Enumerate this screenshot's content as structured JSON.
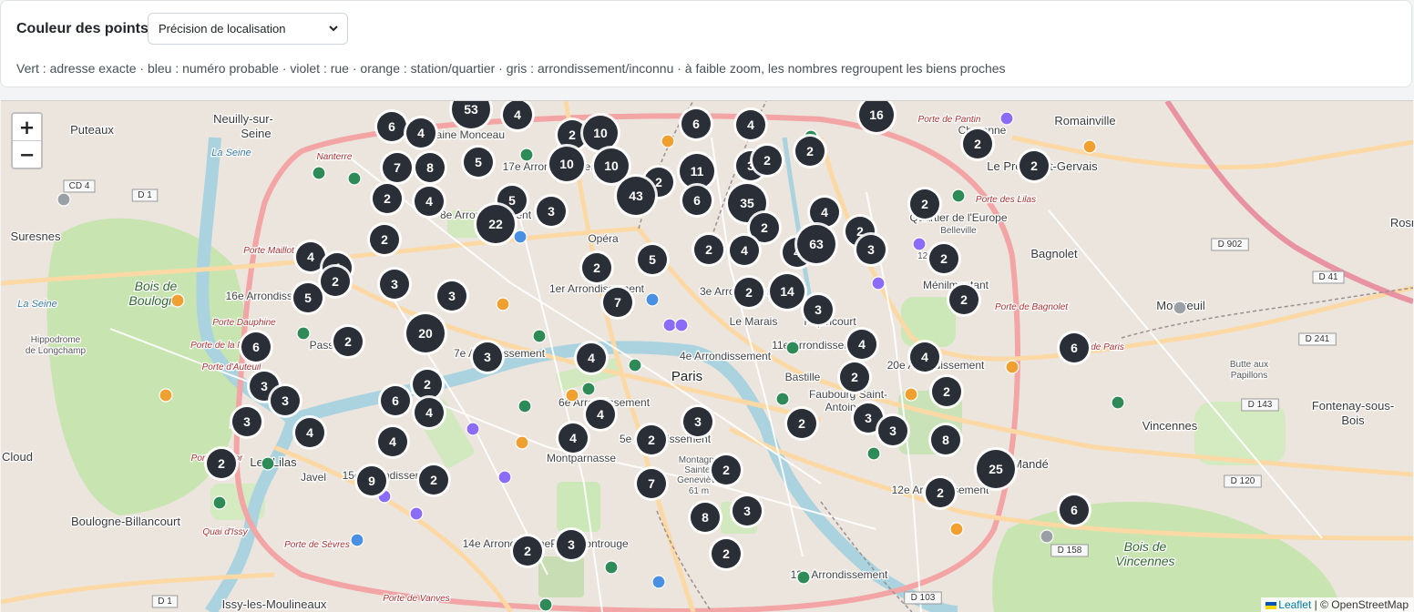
{
  "controls": {
    "color_label": "Couleur des points",
    "color_select_value": "Précision de localisation",
    "legend_text": "Vert : adresse exacte · bleu : numéro probable · violet : rue · orange : station/quartier · gris : arrondissement/inconnu · à faible zoom, les nombres regroupent les biens proches"
  },
  "map": {
    "zoom_in": "+",
    "zoom_out": "−",
    "attribution": {
      "leaflet": "Leaflet",
      "separator": " | © ",
      "osm": "OpenStreetMap"
    },
    "colors": {
      "exact": "#2e8b57",
      "probable": "#4a90e2",
      "street": "#8b6cf6",
      "station": "#f0a030",
      "unknown": "#9aa0a6",
      "cluster": "#2a2e37"
    },
    "place_labels": [
      {
        "text": "Puteaux",
        "cls": "town"
      },
      {
        "text": "Neuilly-sur-",
        "cls": "town"
      },
      {
        "text": "Seine",
        "cls": "town"
      },
      {
        "text": "Suresnes",
        "cls": "town"
      },
      {
        "text": "Bois de",
        "cls": "park"
      },
      {
        "text": "Boulogne",
        "cls": "park"
      },
      {
        "text": "Hippodrome",
        "cls": "small"
      },
      {
        "text": "de Longchamp",
        "cls": "small"
      },
      {
        "text": "Boulogne-Billancourt",
        "cls": "town"
      },
      {
        "text": "Cloud",
        "cls": "town"
      },
      {
        "text": "Issy-les-Moulineaux",
        "cls": "town"
      },
      {
        "text": "Romainville",
        "cls": "town"
      },
      {
        "text": "Bagnolet",
        "cls": "town"
      },
      {
        "text": "Montreuil",
        "cls": "town"
      },
      {
        "text": "Vincennes",
        "cls": "town"
      },
      {
        "text": "Saint-Mandé",
        "cls": "town"
      },
      {
        "text": "Fontenay-sous-",
        "cls": "town"
      },
      {
        "text": "Bois",
        "cls": "town"
      },
      {
        "text": "Bois de",
        "cls": "park"
      },
      {
        "text": "Vincennes",
        "cls": "park"
      },
      {
        "text": "Butte aux",
        "cls": "small"
      },
      {
        "text": "Papillons",
        "cls": "small"
      },
      {
        "text": "Rosn",
        "cls": "town"
      },
      {
        "text": "Paris",
        "cls": "city"
      },
      {
        "text": "Opéra",
        "cls": "district"
      },
      {
        "text": "1er Arrondissement",
        "cls": "district"
      },
      {
        "text": "3e Arrondissement",
        "cls": "district"
      },
      {
        "text": "Le Marais",
        "cls": "district"
      },
      {
        "text": "4e Arrondissement",
        "cls": "district"
      },
      {
        "text": "Bastille",
        "cls": "district"
      },
      {
        "text": "11e Arrondissement",
        "cls": "district"
      },
      {
        "text": "Popincourt",
        "cls": "district"
      },
      {
        "text": "Faubourg Saint-",
        "cls": "district"
      },
      {
        "text": "Antoine",
        "cls": "district"
      },
      {
        "text": "12e Arrondissement",
        "cls": "district"
      },
      {
        "text": "13e Arrondissement",
        "cls": "district"
      },
      {
        "text": "6e Arrondissement",
        "cls": "district"
      },
      {
        "text": "5e Arrondissement",
        "cls": "district"
      },
      {
        "text": "7e Arrondissement",
        "cls": "district"
      },
      {
        "text": "8e Arrondissement",
        "cls": "district"
      },
      {
        "text": "16e Arrondissement",
        "cls": "district"
      },
      {
        "text": "15e Arrondissement",
        "cls": "district"
      },
      {
        "text": "14e Arrondissement",
        "cls": "district"
      },
      {
        "text": "Montparnasse",
        "cls": "district"
      },
      {
        "text": "Petit-Montrouge",
        "cls": "district"
      },
      {
        "text": "Montagne",
        "cls": "small"
      },
      {
        "text": "Sainte-",
        "cls": "small"
      },
      {
        "text": "Geneviève",
        "cls": "small"
      },
      {
        "text": "61 m",
        "cls": "small"
      },
      {
        "text": "Passy",
        "cls": "district"
      },
      {
        "text": "Javel",
        "cls": "district"
      },
      {
        "text": "Auteuil",
        "cls": "district"
      },
      {
        "text": "Plaine Monceau",
        "cls": "district"
      },
      {
        "text": "17e Arrondissement",
        "cls": "district"
      },
      {
        "text": "Quartier de l'Europe",
        "cls": "district"
      },
      {
        "text": "Belleville",
        "cls": "small"
      },
      {
        "text": "129 m",
        "cls": "small"
      },
      {
        "text": "Ménilmontant",
        "cls": "district"
      },
      {
        "text": "20e Arrondissement",
        "cls": "district"
      },
      {
        "text": "Charonne",
        "cls": "district"
      },
      {
        "text": "Le Pré-Saint-Gervais",
        "cls": "town"
      },
      {
        "text": "Les Lilas",
        "cls": "town"
      },
      {
        "text": "La Seine",
        "cls": "water"
      },
      {
        "text": "La Seine",
        "cls": "water"
      },
      {
        "text": "Nanterre",
        "cls": "road"
      },
      {
        "text": "Porte Maillot",
        "cls": "road"
      },
      {
        "text": "Porte Dauphine",
        "cls": "road"
      },
      {
        "text": "Porte de la Muette",
        "cls": "road"
      },
      {
        "text": "Porte d'Auteuil",
        "cls": "road"
      },
      {
        "text": "Porte Molitor",
        "cls": "road"
      },
      {
        "text": "Porte de Sèvres",
        "cls": "road"
      },
      {
        "text": "Porte de Vanves",
        "cls": "road"
      },
      {
        "text": "Porte de Pantin",
        "cls": "road"
      },
      {
        "text": "Porte des Lilas",
        "cls": "road"
      },
      {
        "text": "Porte de Bagnolet",
        "cls": "road"
      },
      {
        "text": "Quai d'Issy",
        "cls": "road"
      },
      {
        "text": "Rue de Paris",
        "cls": "road"
      },
      {
        "text": "CD 4",
        "cls": "shield"
      },
      {
        "text": "D 1",
        "cls": "shield"
      },
      {
        "text": "D 902",
        "cls": "shield"
      },
      {
        "text": "D 41",
        "cls": "shield"
      },
      {
        "text": "D 241",
        "cls": "shield"
      },
      {
        "text": "D 143",
        "cls": "shield"
      },
      {
        "text": "D 120",
        "cls": "shield"
      },
      {
        "text": "D 158",
        "cls": "shield"
      },
      {
        "text": "D 103",
        "cls": "shield"
      },
      {
        "text": "D 1",
        "cls": "shield"
      }
    ],
    "clusters": [
      "53",
      "4",
      "6",
      "4",
      "2",
      "10",
      "6",
      "4",
      "16",
      "2",
      "2",
      "2",
      "7",
      "8",
      "5",
      "10",
      "10",
      "2",
      "11",
      "3",
      "2",
      "2",
      "4",
      "5",
      "3",
      "43",
      "6",
      "35",
      "2",
      "4",
      "2",
      "22",
      "2",
      "2",
      "4",
      "4",
      "2",
      "3",
      "2",
      "4",
      "4",
      "63",
      "3",
      "2",
      "5",
      "3",
      "5",
      "2",
      "2",
      "14",
      "2",
      "3",
      "7",
      "6",
      "2",
      "20",
      "4",
      "4",
      "6",
      "3",
      "4",
      "2",
      "3",
      "3",
      "2",
      "6",
      "3",
      "4",
      "4",
      "4",
      "2",
      "3",
      "2",
      "3",
      "4",
      "4",
      "3",
      "2",
      "8",
      "2",
      "25",
      "2",
      "9",
      "2",
      "2",
      "7",
      "3",
      "8",
      "6",
      "3",
      "2",
      "2"
    ],
    "dots": [
      "exact",
      "exact",
      "exact",
      "exact",
      "exact",
      "exact",
      "exact",
      "exact",
      "exact",
      "exact",
      "exact",
      "exact",
      "exact",
      "exact",
      "exact",
      "exact",
      "exact",
      "exact",
      "exact",
      "probable",
      "probable",
      "probable",
      "probable",
      "street",
      "street",
      "street",
      "street",
      "street",
      "street",
      "street",
      "street",
      "street",
      "station",
      "station",
      "station",
      "station",
      "station",
      "station",
      "station",
      "station",
      "station",
      "station",
      "unknown",
      "unknown",
      "unknown"
    ]
  }
}
